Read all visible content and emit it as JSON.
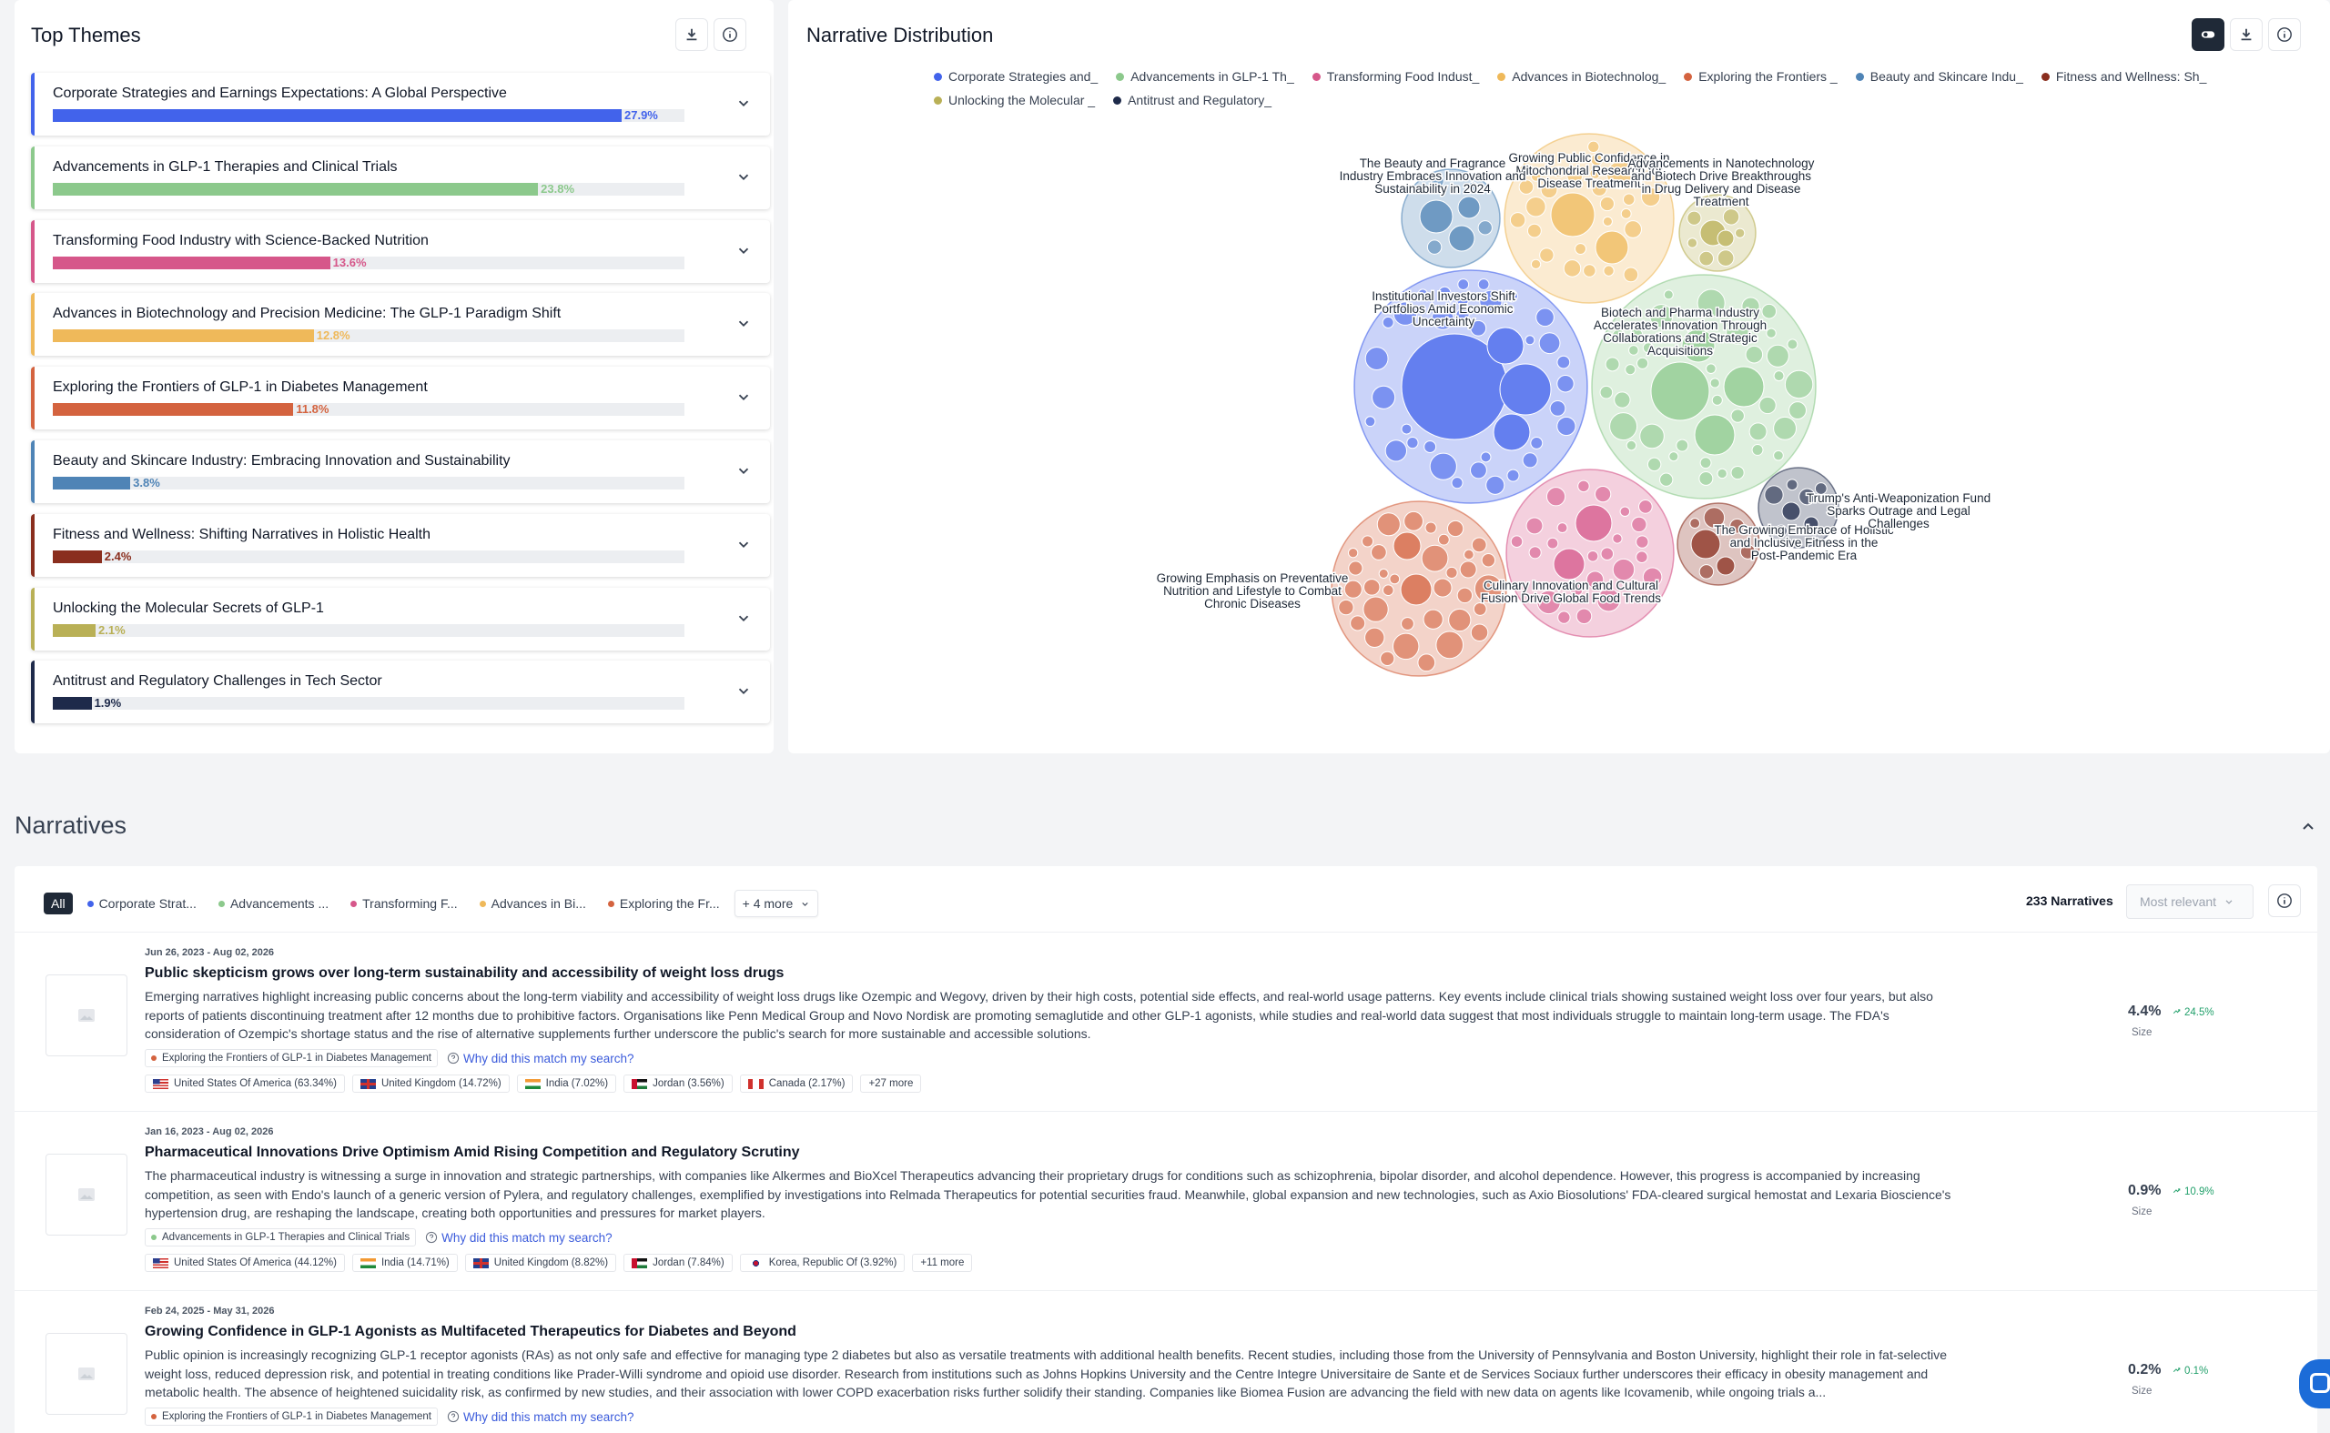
{
  "themes_panel": {
    "title": "Top Themes",
    "themes": [
      {
        "name": "Corporate Strategies and Earnings Expectations: A Global Perspective",
        "pct_label": "27.9%",
        "value": 27.9,
        "color": "#4263eb"
      },
      {
        "name": "Advancements in GLP-1 Therapies and Clinical Trials",
        "pct_label": "23.8%",
        "value": 23.8,
        "color": "#8cc98c"
      },
      {
        "name": "Transforming Food Industry with Science-Backed Nutrition",
        "pct_label": "13.6%",
        "value": 13.6,
        "color": "#d6578a"
      },
      {
        "name": "Advances in Biotechnology and Precision Medicine: The GLP-1 Paradigm Shift",
        "pct_label": "12.8%",
        "value": 12.8,
        "color": "#efb95a"
      },
      {
        "name": "Exploring the Frontiers of GLP-1 in Diabetes Management",
        "pct_label": "11.8%",
        "value": 11.8,
        "color": "#d4633f"
      },
      {
        "name": "Beauty and Skincare Industry: Embracing Innovation and Sustainability",
        "pct_label": "3.8%",
        "value": 3.8,
        "color": "#4f84b6"
      },
      {
        "name": "Fitness and Wellness: Shifting Narratives in Holistic Health",
        "pct_label": "2.4%",
        "value": 2.4,
        "color": "#8a2e1e"
      },
      {
        "name": "Unlocking the Molecular Secrets of GLP-1",
        "pct_label": "2.1%",
        "value": 2.1,
        "color": "#b9b056"
      },
      {
        "name": "Antitrust and Regulatory Challenges in Tech Sector",
        "pct_label": "1.9%",
        "value": 1.9,
        "color": "#1e2a4a"
      }
    ]
  },
  "distribution_panel": {
    "title": "Narrative Distribution",
    "legend": [
      {
        "label": "Corporate Strategies and_",
        "color": "#4263eb"
      },
      {
        "label": "Advancements in GLP-1 Th_",
        "color": "#8cc98c"
      },
      {
        "label": "Transforming Food Indust_",
        "color": "#d6578a"
      },
      {
        "label": "Advances in Biotechnolog_",
        "color": "#efb95a"
      },
      {
        "label": "Exploring the Frontiers _",
        "color": "#d4633f"
      },
      {
        "label": "Beauty and Skincare Indu_",
        "color": "#4f84b6"
      },
      {
        "label": "Fitness and Wellness: Sh_",
        "color": "#8a2e1e"
      },
      {
        "label": "Unlocking the Molecular _",
        "color": "#b9b056"
      },
      {
        "label": "Antitrust and Regulatory_",
        "color": "#1e2a4a"
      }
    ],
    "bubble_labels": {
      "beauty": [
        "The Beauty and Fragrance",
        "Industry Embraces Innovation and",
        "Sustainability in 2024"
      ],
      "biotech": [
        "Growing Public Confidence in",
        "Mitochondrial Research for",
        "Disease Treatment"
      ],
      "molecular": [
        "Advancements in Nanotechnology",
        "and Biotech Drive Breakthroughs",
        "in Drug Delivery and Disease",
        "Treatment"
      ],
      "corporate": [
        "Institutional Investors Shift",
        "Portfolios Amid Economic",
        "Uncertainty"
      ],
      "glp1": [
        "Biotech and Pharma Industry",
        "Accelerates Innovation Through",
        "Collaborations and Strategic",
        "Acquisitions"
      ],
      "antitrust": [
        "Trump's Anti-Weaponization Fund",
        "Sparks Outrage and Legal",
        "Challenges"
      ],
      "fitness": [
        "The Growing Embrace of Holistic",
        "and Inclusive Fitness in the",
        "Post-Pandemic Era"
      ],
      "exploring": [
        "Growing Emphasis on Preventative",
        "Nutrition and Lifestyle to Combat",
        "Chronic Diseases"
      ],
      "food": [
        "Culinary Innovation and Cultural",
        "Fusion Drive Global Food Trends"
      ]
    }
  },
  "narratives_section": {
    "title": "Narratives",
    "filters": {
      "all": "All",
      "chips": [
        {
          "label": "Corporate Strat...",
          "color": "#4263eb"
        },
        {
          "label": "Advancements ...",
          "color": "#8cc98c"
        },
        {
          "label": "Transforming F...",
          "color": "#d6578a"
        },
        {
          "label": "Advances in Bi...",
          "color": "#efb95a"
        },
        {
          "label": "Exploring the Fr...",
          "color": "#d4633f"
        }
      ],
      "more": "+ 4 more"
    },
    "count": "233 Narratives",
    "sort": "Most relevant",
    "items": [
      {
        "date": "Jun 26, 2023 - Aug 02, 2026",
        "title": "Public skepticism grows over long-term sustainability and accessibility of weight loss drugs",
        "body": "Emerging narratives highlight increasing public concerns about the long-term viability and accessibility of weight loss drugs like Ozempic and Wegovy, driven by their high costs, potential side effects, and real-world usage patterns. Key events include clinical trials showing sustained weight loss over four years, but also reports of patients discontinuing treatment after 12 months due to prohibitive factors. Organisations like Penn Medical Group and Novo Nordisk are promoting semaglutide and other GLP-1 agonists, while studies and real-world data suggest that most individuals struggle to maintain long-term usage. The FDA's consideration of Ozempic's shortage status and the rise of alternative supplements further underscore the public's search for more sustainable and accessible solutions.",
        "tag": "Exploring the Frontiers of GLP-1 in Diabetes Management",
        "tag_color": "#d4633f",
        "why": "Why did this match my search?",
        "countries": [
          "United States Of America (63.34%)",
          "United Kingdom (14.72%)",
          "India (7.02%)",
          "Jordan (3.56%)",
          "Canada (2.17%)"
        ],
        "flags": [
          "us",
          "uk",
          "in",
          "jo",
          "ca"
        ],
        "more": "+27 more",
        "size": "4.4%",
        "growth": "24.5%",
        "size_label": "Size"
      },
      {
        "date": "Jan 16, 2023 - Aug 02, 2026",
        "title": "Pharmaceutical Innovations Drive Optimism Amid Rising Competition and Regulatory Scrutiny",
        "body": "The pharmaceutical industry is witnessing a surge in innovation and strategic partnerships, with companies like Alkermes and BioXcel Therapeutics advancing their proprietary drugs for conditions such as schizophrenia, bipolar disorder, and alcohol dependence. However, this progress is accompanied by increasing competition, as seen with Endo's launch of a generic version of Pylera, and regulatory challenges, exemplified by investigations into Relmada Therapeutics for potential securities fraud. Meanwhile, global expansion and new technologies, such as Axio Biosolutions' FDA-cleared surgical hemostat and Lexaria Bioscience's hypertension drug, are reshaping the landscape, creating both opportunities and pressures for market players.",
        "tag": "Advancements in GLP-1 Therapies and Clinical Trials",
        "tag_color": "#8cc98c",
        "why": "Why did this match my search?",
        "countries": [
          "United States Of America (44.12%)",
          "India (14.71%)",
          "United Kingdom (8.82%)",
          "Jordan (7.84%)",
          "Korea, Republic Of (3.92%)"
        ],
        "flags": [
          "us",
          "in",
          "uk",
          "jo",
          "kr"
        ],
        "more": "+11 more",
        "size": "0.9%",
        "growth": "10.9%",
        "size_label": "Size"
      },
      {
        "date": "Feb 24, 2025 - May 31, 2026",
        "title": "Growing Confidence in GLP-1 Agonists as Multifaceted Therapeutics for Diabetes and Beyond",
        "body": "Public opinion is increasingly recognizing GLP-1 receptor agonists (RAs) as not only safe and effective for managing type 2 diabetes but also as versatile treatments with additional health benefits. Recent studies, including those from the University of Pennsylvania and Boston University, highlight their role in fat-selective weight loss, reduced depression risk, and potential in treating conditions like Prader-Willi syndrome and opioid use disorder. Research from institutions such as Johns Hopkins University and the Centre Integre Universitaire de Sante et de Services Sociaux further underscores their efficacy in obesity management and metabolic health. The absence of heightened suicidality risk, as confirmed by new studies, and their association with lower COPD exacerbation risks further solidify their standing. Companies like Biomea Fusion are advancing the field with new data on agents like Icovamenib, while ongoing trials a...",
        "tag": "Exploring the Frontiers of GLP-1 in Diabetes Management",
        "tag_color": "#d4633f",
        "why": "Why did this match my search?",
        "countries": [],
        "flags": [],
        "more": "",
        "size": "0.2%",
        "growth": "0.1%",
        "size_label": "Size"
      }
    ]
  },
  "icons": {
    "download": "download-icon",
    "info": "info-icon",
    "toggle": "toggle-icon",
    "chevron": "chevron-down-icon",
    "collapse": "chevron-up-icon",
    "image": "image-placeholder-icon",
    "question": "question-icon",
    "trend": "trend-up-icon",
    "chat": "chat-icon"
  }
}
